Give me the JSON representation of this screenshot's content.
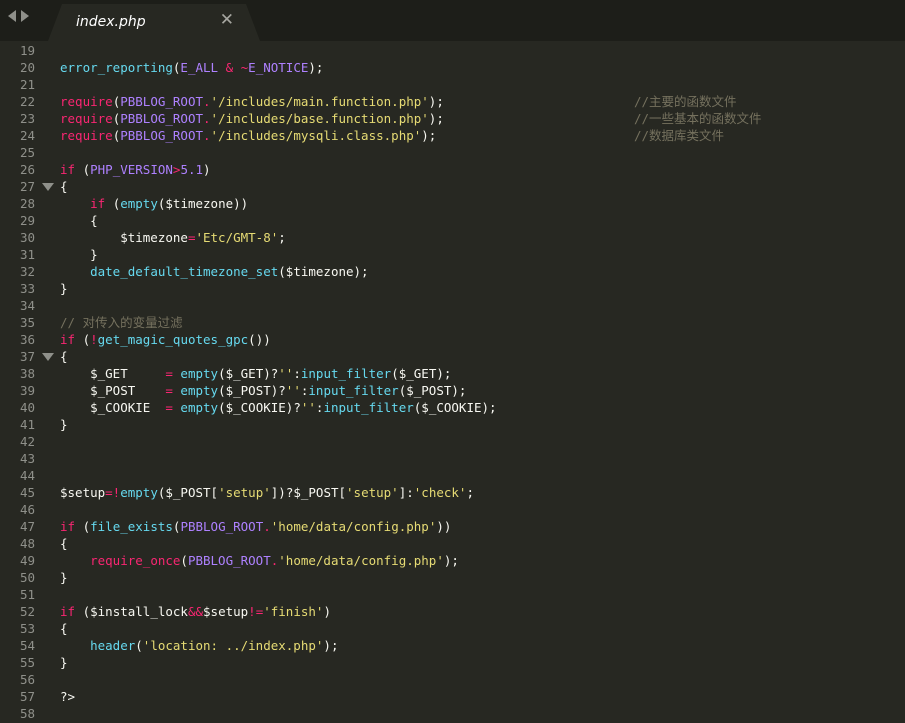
{
  "tab": {
    "title": "index.php",
    "close": "✕"
  },
  "colors": {
    "background": "#272822",
    "keyword": "#f92672",
    "function": "#66d9ef",
    "constant": "#ae81ff",
    "string": "#e6db74",
    "comment": "#75715e",
    "text": "#f8f8f2",
    "gutter": "#8f908a"
  },
  "icons": [
    "nav-back-icon",
    "nav-forward-icon",
    "close-icon",
    "fold-arrow-icon"
  ],
  "lines": [
    {
      "num": "19",
      "tokens": []
    },
    {
      "num": "20",
      "tokens": [
        [
          "f",
          "error_reporting"
        ],
        [
          "",
          "("
        ],
        [
          "c",
          "E_ALL"
        ],
        [
          "k",
          " & ~"
        ],
        [
          "c",
          "E_NOTICE"
        ],
        [
          "",
          ");"
        ]
      ]
    },
    {
      "num": "21",
      "tokens": []
    },
    {
      "num": "22",
      "tokens": [
        [
          "k",
          "require"
        ],
        [
          "",
          "("
        ],
        [
          "c",
          "PBBLOG_ROOT"
        ],
        [
          "k",
          "."
        ],
        [
          "s",
          "'/includes/main.function.php'"
        ],
        [
          "",
          ");"
        ]
      ],
      "comment": "//主要的函数文件"
    },
    {
      "num": "23",
      "tokens": [
        [
          "k",
          "require"
        ],
        [
          "",
          "("
        ],
        [
          "c",
          "PBBLOG_ROOT"
        ],
        [
          "k",
          "."
        ],
        [
          "s",
          "'/includes/base.function.php'"
        ],
        [
          "",
          ");"
        ]
      ],
      "comment": "//一些基本的函数文件"
    },
    {
      "num": "24",
      "tokens": [
        [
          "k",
          "require"
        ],
        [
          "",
          "("
        ],
        [
          "c",
          "PBBLOG_ROOT"
        ],
        [
          "k",
          "."
        ],
        [
          "s",
          "'/includes/mysqli.class.php'"
        ],
        [
          "",
          ");"
        ]
      ],
      "comment": "//数据库类文件"
    },
    {
      "num": "25",
      "tokens": []
    },
    {
      "num": "26",
      "tokens": [
        [
          "k",
          "if"
        ],
        [
          "",
          " ("
        ],
        [
          "c",
          "PHP_VERSION"
        ],
        [
          "k",
          ">"
        ],
        [
          "c",
          "5.1"
        ],
        [
          "",
          ")"
        ]
      ]
    },
    {
      "num": "27",
      "fold": true,
      "tokens": [
        [
          "",
          "{"
        ]
      ]
    },
    {
      "num": "28",
      "tokens": [
        [
          "",
          "    "
        ],
        [
          "k",
          "if"
        ],
        [
          "",
          " ("
        ],
        [
          "f",
          "empty"
        ],
        [
          "",
          "($timezone))"
        ]
      ]
    },
    {
      "num": "29",
      "tokens": [
        [
          "",
          "    {"
        ]
      ]
    },
    {
      "num": "30",
      "tokens": [
        [
          "",
          "        $timezone"
        ],
        [
          "k",
          "="
        ],
        [
          "s",
          "'Etc/GMT-8'"
        ],
        [
          "",
          ";"
        ]
      ]
    },
    {
      "num": "31",
      "tokens": [
        [
          "",
          "    }"
        ]
      ]
    },
    {
      "num": "32",
      "tokens": [
        [
          "",
          "    "
        ],
        [
          "f",
          "date_default_timezone_set"
        ],
        [
          "",
          "($timezone);"
        ]
      ]
    },
    {
      "num": "33",
      "tokens": [
        [
          "",
          "}"
        ]
      ]
    },
    {
      "num": "34",
      "tokens": []
    },
    {
      "num": "35",
      "tokens": [
        [
          "m",
          "// 对传入的变量过滤"
        ]
      ]
    },
    {
      "num": "36",
      "tokens": [
        [
          "k",
          "if"
        ],
        [
          "",
          " ("
        ],
        [
          "k",
          "!"
        ],
        [
          "f",
          "get_magic_quotes_gpc"
        ],
        [
          "",
          "())"
        ]
      ]
    },
    {
      "num": "37",
      "fold": true,
      "tokens": [
        [
          "",
          "{"
        ]
      ]
    },
    {
      "num": "38",
      "tokens": [
        [
          "",
          "    $_GET     "
        ],
        [
          "k",
          "="
        ],
        [
          "",
          " "
        ],
        [
          "f",
          "empty"
        ],
        [
          "",
          "($_GET)?"
        ],
        [
          "s",
          "''"
        ],
        [
          "",
          ":"
        ],
        [
          "f",
          "input_filter"
        ],
        [
          "",
          "($_GET);"
        ]
      ]
    },
    {
      "num": "39",
      "tokens": [
        [
          "",
          "    $_POST    "
        ],
        [
          "k",
          "="
        ],
        [
          "",
          " "
        ],
        [
          "f",
          "empty"
        ],
        [
          "",
          "($_POST)?"
        ],
        [
          "s",
          "''"
        ],
        [
          "",
          ":"
        ],
        [
          "f",
          "input_filter"
        ],
        [
          "",
          "($_POST);"
        ]
      ]
    },
    {
      "num": "40",
      "tokens": [
        [
          "",
          "    $_COOKIE  "
        ],
        [
          "k",
          "="
        ],
        [
          "",
          " "
        ],
        [
          "f",
          "empty"
        ],
        [
          "",
          "($_COOKIE)?"
        ],
        [
          "s",
          "''"
        ],
        [
          "",
          ":"
        ],
        [
          "f",
          "input_filter"
        ],
        [
          "",
          "($_COOKIE);"
        ]
      ]
    },
    {
      "num": "41",
      "tokens": [
        [
          "",
          "}"
        ]
      ]
    },
    {
      "num": "42",
      "tokens": []
    },
    {
      "num": "43",
      "tokens": []
    },
    {
      "num": "44",
      "tokens": []
    },
    {
      "num": "45",
      "tokens": [
        [
          "",
          "$setup"
        ],
        [
          "k",
          "=!"
        ],
        [
          "f",
          "empty"
        ],
        [
          "",
          "($_POST["
        ],
        [
          "s",
          "'setup'"
        ],
        [
          "",
          "])?$_POST["
        ],
        [
          "s",
          "'setup'"
        ],
        [
          "",
          "]:"
        ],
        [
          "s",
          "'check'"
        ],
        [
          "",
          ";"
        ]
      ]
    },
    {
      "num": "46",
      "tokens": []
    },
    {
      "num": "47",
      "tokens": [
        [
          "k",
          "if"
        ],
        [
          "",
          " ("
        ],
        [
          "f",
          "file_exists"
        ],
        [
          "",
          "("
        ],
        [
          "c",
          "PBBLOG_ROOT"
        ],
        [
          "k",
          "."
        ],
        [
          "s",
          "'home/data/config.php'"
        ],
        [
          "",
          "))"
        ]
      ]
    },
    {
      "num": "48",
      "tokens": [
        [
          "",
          "{"
        ]
      ]
    },
    {
      "num": "49",
      "tokens": [
        [
          "",
          "    "
        ],
        [
          "k",
          "require_once"
        ],
        [
          "",
          "("
        ],
        [
          "c",
          "PBBLOG_ROOT"
        ],
        [
          "k",
          "."
        ],
        [
          "s",
          "'home/data/config.php'"
        ],
        [
          "",
          ");"
        ]
      ]
    },
    {
      "num": "50",
      "tokens": [
        [
          "",
          "}"
        ]
      ]
    },
    {
      "num": "51",
      "tokens": []
    },
    {
      "num": "52",
      "tokens": [
        [
          "k",
          "if"
        ],
        [
          "",
          " ($install_lock"
        ],
        [
          "k",
          "&&"
        ],
        [
          "",
          "$setup"
        ],
        [
          "k",
          "!="
        ],
        [
          "s",
          "'finish'"
        ],
        [
          "",
          ")"
        ]
      ]
    },
    {
      "num": "53",
      "tokens": [
        [
          "",
          "{"
        ]
      ]
    },
    {
      "num": "54",
      "tokens": [
        [
          "",
          "    "
        ],
        [
          "f",
          "header"
        ],
        [
          "",
          "("
        ],
        [
          "s",
          "'location: ../index.php'"
        ],
        [
          "",
          ");"
        ]
      ]
    },
    {
      "num": "55",
      "tokens": [
        [
          "",
          "}"
        ]
      ]
    },
    {
      "num": "56",
      "tokens": []
    },
    {
      "num": "57",
      "tokens": [
        [
          "",
          "?>"
        ]
      ]
    },
    {
      "num": "58",
      "tokens": []
    }
  ]
}
